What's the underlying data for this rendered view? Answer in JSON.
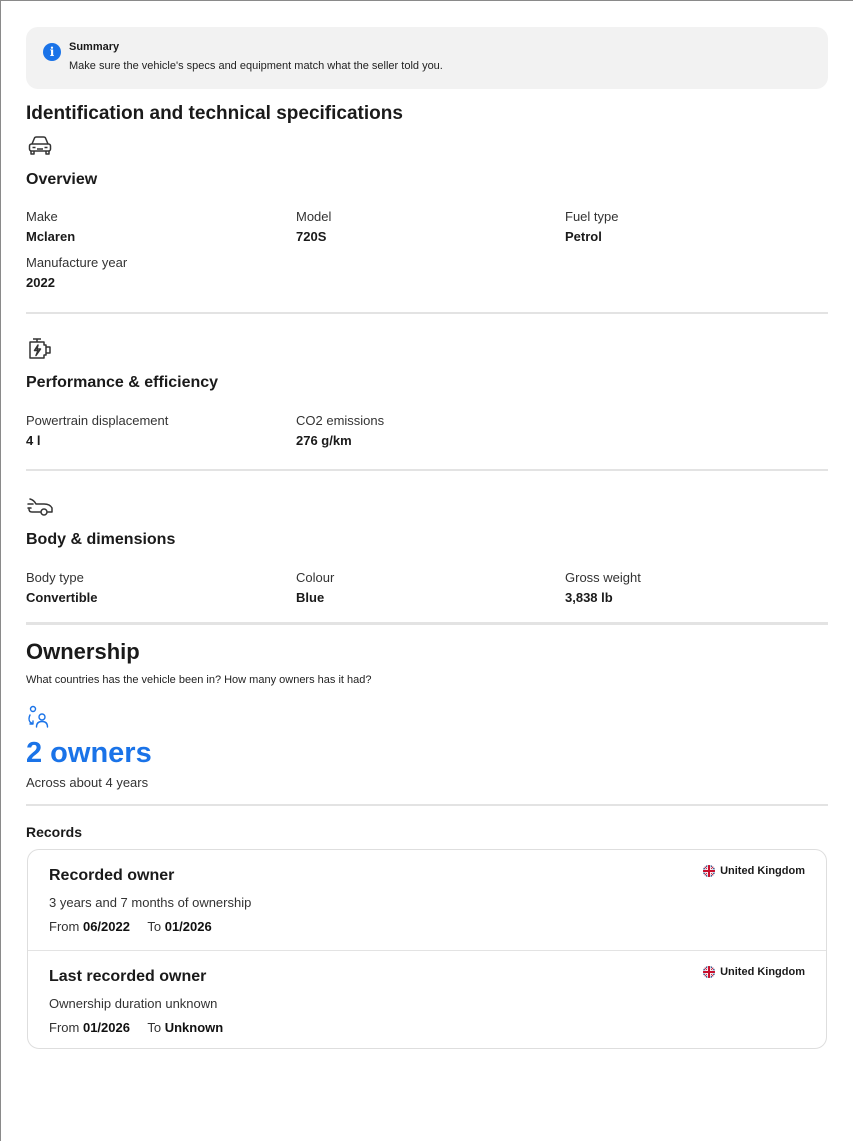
{
  "summary": {
    "title": "Summary",
    "text": "Make sure the vehicle's specs and equipment match what the seller told you."
  },
  "identification": {
    "heading": "Identification and technical specifications",
    "overview": {
      "title": "Overview",
      "make_label": "Make",
      "make_value": "Mclaren",
      "model_label": "Model",
      "model_value": "720S",
      "fuel_label": "Fuel type",
      "fuel_value": "Petrol",
      "year_label": "Manufacture year",
      "year_value": "2022"
    },
    "performance": {
      "title": "Performance & efficiency",
      "displacement_label": "Powertrain displacement",
      "displacement_value": "4 l",
      "co2_label": "CO2 emissions",
      "co2_value": "276 g/km"
    },
    "body": {
      "title": "Body & dimensions",
      "type_label": "Body type",
      "type_value": "Convertible",
      "colour_label": "Colour",
      "colour_value": "Blue",
      "weight_label": "Gross weight",
      "weight_value": "3,838 lb"
    }
  },
  "ownership": {
    "title": "Ownership",
    "subtitle": "What countries has the vehicle been in? How many owners has it had?",
    "owners_count": "2 owners",
    "span": "Across about 4 years",
    "records_label": "Records",
    "records": [
      {
        "title": "Recorded owner",
        "duration": "3 years and 7 months of ownership",
        "from_label": "From",
        "from_value": "06/2022",
        "to_label": "To",
        "to_value": "01/2026",
        "country": "United Kingdom"
      },
      {
        "title": "Last recorded owner",
        "duration": "Ownership duration unknown",
        "from_label": "From",
        "from_value": "01/2026",
        "to_label": "To",
        "to_value": "Unknown",
        "country": "United Kingdom"
      }
    ]
  },
  "colors": {
    "accent": "#1a73e8",
    "divider": "#e3e3e3",
    "summary_bg": "#f2f2f2"
  }
}
